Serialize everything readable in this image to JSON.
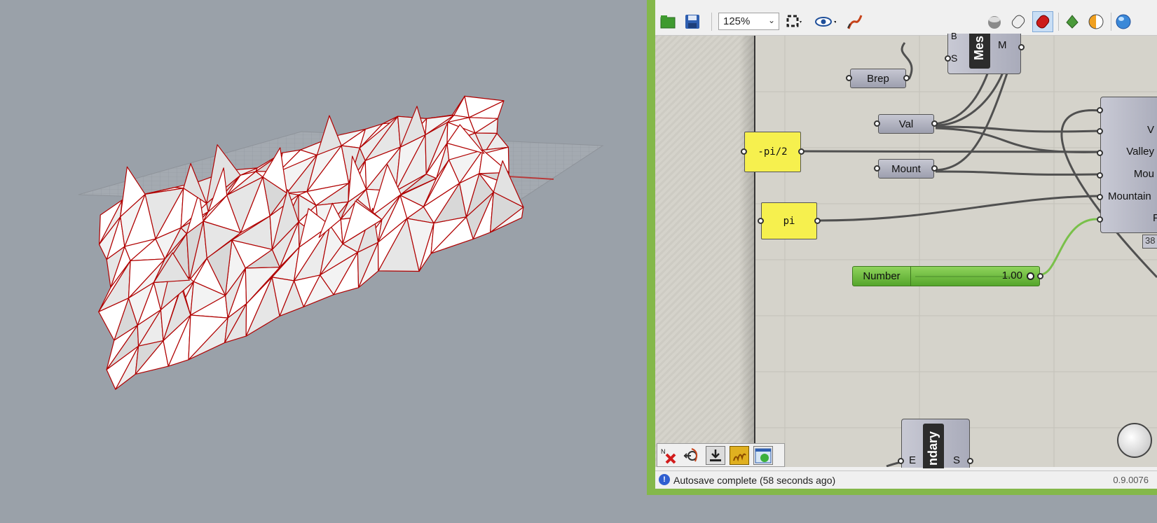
{
  "toolbar": {
    "zoom_value": "125%",
    "zoom_arrow": "⌄"
  },
  "canvas": {
    "brep_label": "Brep",
    "val_label": "Val",
    "mount_label": "Mount",
    "neg_pi2_label": "-pi/2",
    "pi_label": "pi",
    "mesh_label": "Mes",
    "mesh_b": "B",
    "mesh_s": "S",
    "mesh_m": "M",
    "boundary_label": "ndary",
    "boundary_e": "E",
    "boundary_s": "S",
    "right_inputs": [
      "V",
      "Valley",
      "Mou",
      "Mountain",
      "Fa"
    ],
    "right_badge": "38",
    "slider": {
      "name": "Number",
      "value": "1.00",
      "fraction": 1.0
    }
  },
  "status": {
    "text": "Autosave complete (58 seconds ago)",
    "version": "0.9.0076"
  },
  "colors": {
    "window_frame": "#84b84a",
    "canvas_bg": "#d5d3cb",
    "viewport_bg": "#9aa1a9",
    "mesh_stroke": "#b00000",
    "yellow_panel": "#f6f04e",
    "slider_green": "#6cbf3a"
  }
}
